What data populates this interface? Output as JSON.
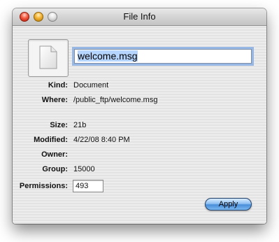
{
  "window": {
    "title": "File Info"
  },
  "file": {
    "name": "welcome.msg",
    "icon": "document-icon"
  },
  "info": {
    "kind_label": "Kind:",
    "kind_value": "Document",
    "where_label": "Where:",
    "where_value": "/public_ftp/welcome.msg",
    "size_label": "Size:",
    "size_value": "21b",
    "modified_label": "Modified:",
    "modified_value": "4/22/08 8:40 PM",
    "owner_label": "Owner:",
    "owner_value": "",
    "group_label": "Group:",
    "group_value": "15000",
    "permissions_label": "Permissions:",
    "permissions_value": "493"
  },
  "actions": {
    "apply_label": "Apply"
  },
  "colors": {
    "apply_button": "#5a9be0",
    "focus_ring": "#97b8e4",
    "close": "#f2593f",
    "minimize": "#f3b233"
  }
}
